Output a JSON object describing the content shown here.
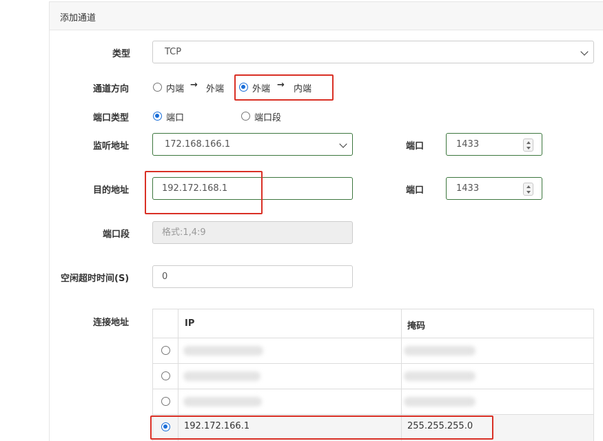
{
  "panel": {
    "title": "添加通道"
  },
  "form": {
    "type": {
      "label": "类型",
      "value": "TCP"
    },
    "direction": {
      "label": "通道方向",
      "options": [
        {
          "from": "内端",
          "arrow": "→",
          "to": "外端",
          "selected": false
        },
        {
          "from": "外端",
          "arrow": "→",
          "to": "内端",
          "selected": true
        }
      ]
    },
    "port_type": {
      "label": "端口类型",
      "options": [
        {
          "label": "端口",
          "selected": true
        },
        {
          "label": "端口段",
          "selected": false
        }
      ]
    },
    "listen": {
      "label": "监听地址",
      "value": "172.168.166.1",
      "port_label": "端口",
      "port_value": "1433"
    },
    "dest": {
      "label": "目的地址",
      "value": "192.172.168.1",
      "port_label": "端口",
      "port_value": "1433"
    },
    "port_range": {
      "label": "端口段",
      "placeholder": "格式:1,4:9"
    },
    "idle": {
      "label": "空闲超时时间(S)",
      "value": "0"
    },
    "conn": {
      "label": "连接地址",
      "headers": {
        "ip": "IP",
        "mask": "掩码"
      },
      "selected_row": {
        "ip": "192.172.166.1",
        "mask": "255.255.255.0"
      }
    }
  },
  "colors": {
    "accent": "#1a6ed8",
    "highlight": "#d93025",
    "valid_border": "#3c763d"
  },
  "icons": {
    "select": "chevron-down-icon",
    "spinner": "spinner-arrows-icon"
  }
}
